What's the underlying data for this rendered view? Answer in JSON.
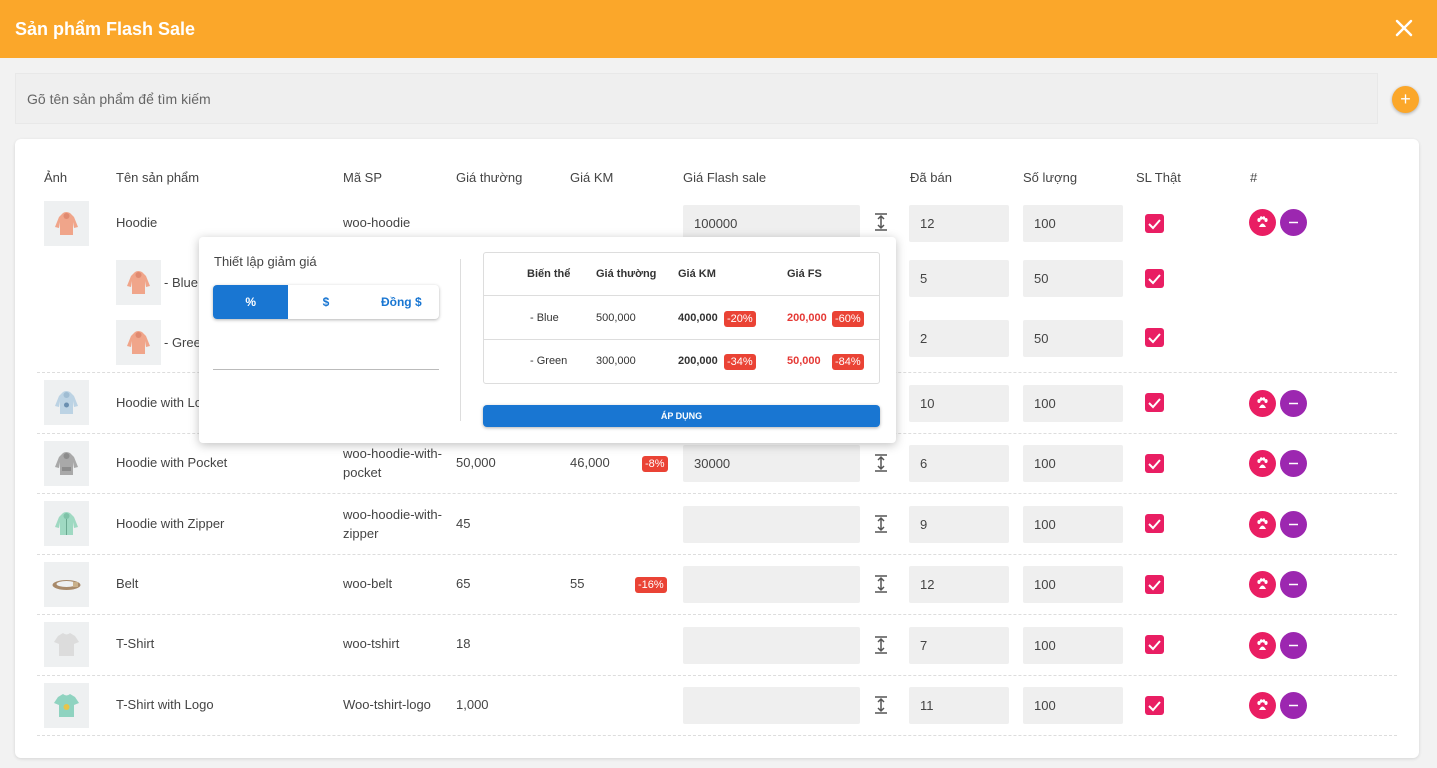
{
  "header": {
    "title": "Sản phẩm Flash Sale"
  },
  "search": {
    "placeholder": "Gõ tên sản phẩm để tìm kiếm"
  },
  "table": {
    "columns": [
      "Ảnh",
      "Tên sản phẩm",
      "Mã SP",
      "Giá thường",
      "Giá KM",
      "Giá Flash sale",
      "Đã bán",
      "Số lượng",
      "SL Thật",
      "#"
    ],
    "rows": [
      {
        "name": "Hoodie",
        "sku": "woo-hoodie",
        "price": "",
        "sale": "",
        "badge": "",
        "fs": "100000",
        "sold": "12",
        "qty": "100",
        "thumb": "hoodie-pink"
      },
      {
        "name": "- Blue",
        "sku": "",
        "price": "",
        "sale": "",
        "badge": "",
        "fs": "",
        "sold": "5",
        "qty": "50",
        "thumb": "hoodie-pink"
      },
      {
        "name": "- Green",
        "sku": "",
        "price": "",
        "sale": "",
        "badge": "",
        "fs": "",
        "sold": "2",
        "qty": "50",
        "thumb": "hoodie-pink"
      },
      {
        "name": "Hoodie with Logo",
        "sku": "",
        "price": "",
        "sale": "",
        "badge": "",
        "fs": "",
        "sold": "10",
        "qty": "100",
        "thumb": "hoodie-blue"
      },
      {
        "name": "Hoodie with Pocket",
        "sku1": "woo-hoodie-with-",
        "sku2": "pocket",
        "price": "50,000",
        "sale": "46,000",
        "badge": "-8%",
        "fs": "30000",
        "sold": "6",
        "qty": "100",
        "thumb": "hoodie-gray"
      },
      {
        "name": "Hoodie with Zipper",
        "sku1": "woo-hoodie-with-",
        "sku2": "zipper",
        "price": "45",
        "sale": "",
        "badge": "",
        "fs": "",
        "sold": "9",
        "qty": "100",
        "thumb": "hoodie-green"
      },
      {
        "name": "Belt",
        "sku": "woo-belt",
        "price": "65",
        "sale": "55",
        "badge": "-16%",
        "fs": "",
        "sold": "12",
        "qty": "100",
        "thumb": "belt"
      },
      {
        "name": "T-Shirt",
        "sku": "woo-tshirt",
        "price": "18",
        "sale": "",
        "badge": "",
        "fs": "",
        "sold": "7",
        "qty": "100",
        "thumb": "tshirt-gray"
      },
      {
        "name": "T-Shirt with Logo",
        "sku": "Woo-tshirt-logo",
        "price": "1,000",
        "sale": "",
        "badge": "",
        "fs": "",
        "sold": "11",
        "qty": "100",
        "thumb": "tshirt-teal"
      }
    ]
  },
  "popup": {
    "title": "Thiết lập giảm giá",
    "options": [
      "%",
      "$",
      "Đồng $"
    ],
    "selected": "%",
    "variant_table": {
      "headers": [
        "Biến thể",
        "Giá thường",
        "Giá KM",
        "Giá FS"
      ],
      "rows": [
        {
          "variant": "- Blue",
          "price": "500,000",
          "sale": "400,000",
          "sale_badge": "-20%",
          "fs": "200,000",
          "fs_badge": "-60%"
        },
        {
          "variant": "- Green",
          "price": "300,000",
          "sale": "200,000",
          "sale_badge": "-34%",
          "fs": "50,000",
          "fs_badge": "-84%"
        }
      ]
    },
    "apply_label": "ÁP DỤNG"
  },
  "colors": {
    "accent": "#fba72a",
    "primary": "#1976d2",
    "pink": "#e91e63",
    "purple": "#9c27b0",
    "badge": "#ea4335"
  }
}
